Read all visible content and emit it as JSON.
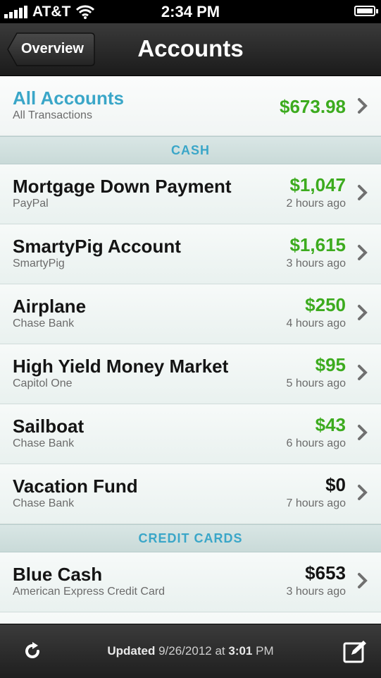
{
  "status_bar": {
    "carrier": "AT&T",
    "time": "2:34 PM"
  },
  "nav": {
    "back_label": "Overview",
    "title": "Accounts"
  },
  "all_accounts": {
    "name": "All Accounts",
    "subtitle": "All Transactions",
    "amount": "$673.98"
  },
  "sections": [
    {
      "header": "CASH",
      "rows": [
        {
          "name": "Mortgage Down Payment",
          "institution": "PayPal",
          "amount": "$1,047",
          "updated": "2 hours ago",
          "amount_color": "green"
        },
        {
          "name": "SmartyPig Account",
          "institution": "SmartyPig",
          "amount": "$1,615",
          "updated": "3 hours ago",
          "amount_color": "green"
        },
        {
          "name": "Airplane",
          "institution": "Chase Bank",
          "amount": "$250",
          "updated": "4 hours ago",
          "amount_color": "green"
        },
        {
          "name": "High Yield Money Market",
          "institution": "Capitol One",
          "amount": "$95",
          "updated": "5 hours ago",
          "amount_color": "green"
        },
        {
          "name": "Sailboat",
          "institution": "Chase Bank",
          "amount": "$43",
          "updated": "6 hours ago",
          "amount_color": "green"
        },
        {
          "name": "Vacation Fund",
          "institution": "Chase Bank",
          "amount": "$0",
          "updated": "7 hours ago",
          "amount_color": "black"
        }
      ]
    },
    {
      "header": "CREDIT CARDS",
      "rows": [
        {
          "name": "Blue Cash",
          "institution": "American Express Credit Card",
          "amount": "$653",
          "updated": "3 hours ago",
          "amount_color": "black"
        }
      ]
    }
  ],
  "toolbar": {
    "updated_label": "Updated",
    "updated_date": "9/26/2012 at",
    "updated_time": "3:01",
    "updated_ampm": "PM"
  },
  "colors": {
    "green": "#3cab1e",
    "accent": "#3aa6c8",
    "black": "#141414"
  },
  "icons": {
    "refresh": "refresh-icon",
    "compose": "compose-icon",
    "chevron": "chevron-right-icon"
  }
}
